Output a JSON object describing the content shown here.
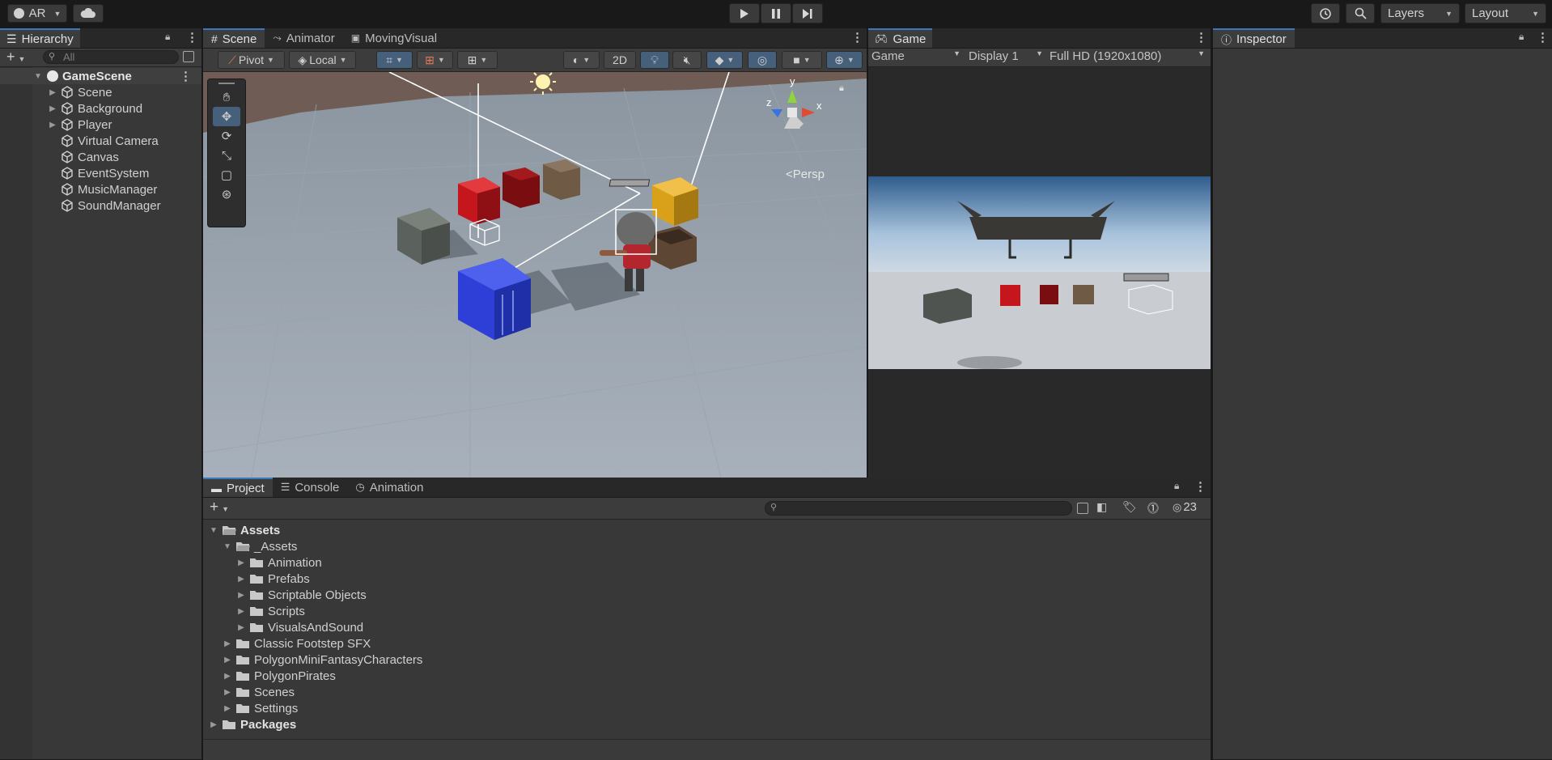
{
  "topbar": {
    "account": "AR",
    "layers": "Layers",
    "layout": "Layout"
  },
  "hierarchy": {
    "tab": "Hierarchy",
    "search_placeholder": "All",
    "scene": "GameScene",
    "items": [
      {
        "label": "Scene",
        "expandable": true
      },
      {
        "label": "Background",
        "expandable": true
      },
      {
        "label": "Player",
        "expandable": true
      },
      {
        "label": "Virtual Camera",
        "expandable": false
      },
      {
        "label": "Canvas",
        "expandable": false
      },
      {
        "label": "EventSystem",
        "expandable": false
      },
      {
        "label": "MusicManager",
        "expandable": false
      },
      {
        "label": "SoundManager",
        "expandable": false
      }
    ]
  },
  "scene_tabs": [
    "Scene",
    "Animator",
    "MovingVisual"
  ],
  "scene_toolbar": {
    "pivot": "Pivot",
    "local": "Local",
    "two_d": "2D"
  },
  "scene_view": {
    "persp": "<Persp",
    "axis_y": "y",
    "axis_x": "x",
    "axis_z": "z"
  },
  "game": {
    "tab": "Game",
    "mode": "Game",
    "display": "Display 1",
    "resolution": "Full HD (1920x1080)"
  },
  "inspector": {
    "tab": "Inspector"
  },
  "bottom_tabs": [
    "Project",
    "Console",
    "Animation"
  ],
  "project": {
    "hidden_count": "23",
    "tree": [
      {
        "label": "Assets",
        "level": 0,
        "open": true,
        "bold": true
      },
      {
        "label": "_Assets",
        "level": 1,
        "open": true,
        "bold": false
      },
      {
        "label": "Animation",
        "level": 2,
        "open": false,
        "bold": false
      },
      {
        "label": "Prefabs",
        "level": 2,
        "open": false,
        "bold": false
      },
      {
        "label": "Scriptable Objects",
        "level": 2,
        "open": false,
        "bold": false
      },
      {
        "label": "Scripts",
        "level": 2,
        "open": false,
        "bold": false
      },
      {
        "label": "VisualsAndSound",
        "level": 2,
        "open": false,
        "bold": false
      },
      {
        "label": "Classic Footstep SFX",
        "level": 1,
        "open": false,
        "bold": false
      },
      {
        "label": "PolygonMiniFantasyCharacters",
        "level": 1,
        "open": false,
        "bold": false
      },
      {
        "label": "PolygonPirates",
        "level": 1,
        "open": false,
        "bold": false
      },
      {
        "label": "Scenes",
        "level": 1,
        "open": false,
        "bold": false
      },
      {
        "label": "Settings",
        "level": 1,
        "open": false,
        "bold": false
      },
      {
        "label": "Packages",
        "level": 0,
        "open": false,
        "bold": true
      }
    ]
  },
  "colors": {
    "accent": "#3a79bb",
    "crate_blue": "#2d3fd6",
    "crate_red": "#c4161c",
    "crate_dark_red": "#7a0d10",
    "crate_yellow": "#d9a019",
    "crate_gray": "#5b615c",
    "crate_brown": "#6e5a45"
  }
}
